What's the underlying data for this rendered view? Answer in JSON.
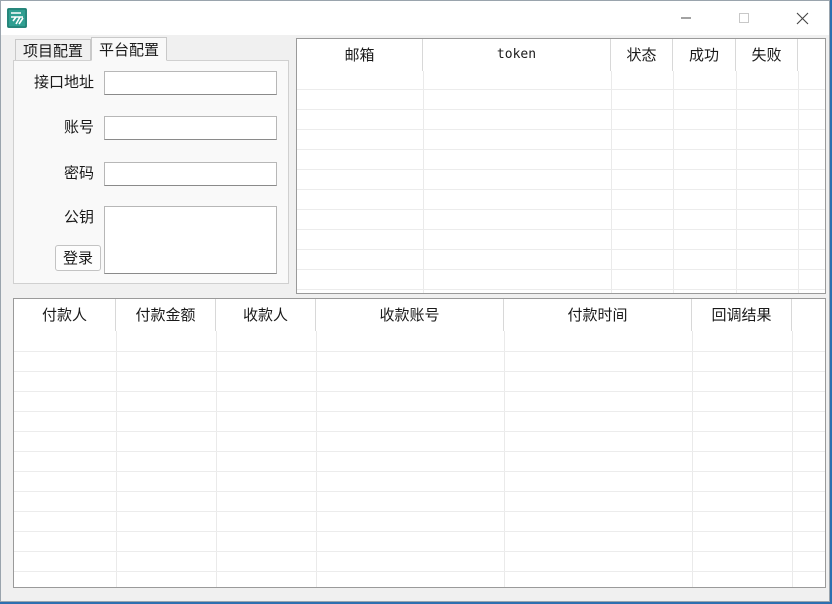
{
  "tabs": {
    "project_label": "项目配置",
    "platform_label": "平台配置"
  },
  "form": {
    "api_address_label": "接口地址",
    "api_address_value": "",
    "account_label": "账号",
    "account_value": "",
    "password_label": "密码",
    "password_value": "",
    "public_key_label": "公钥",
    "public_key_value": "",
    "login_label": "登录"
  },
  "accounts_table": {
    "columns": [
      "邮箱",
      "token",
      "状态",
      "成功",
      "失败"
    ],
    "rows": []
  },
  "payments_table": {
    "columns": [
      "付款人",
      "付款金额",
      "收款人",
      "收款账号",
      "付款时间",
      "回调结果"
    ],
    "rows": []
  }
}
